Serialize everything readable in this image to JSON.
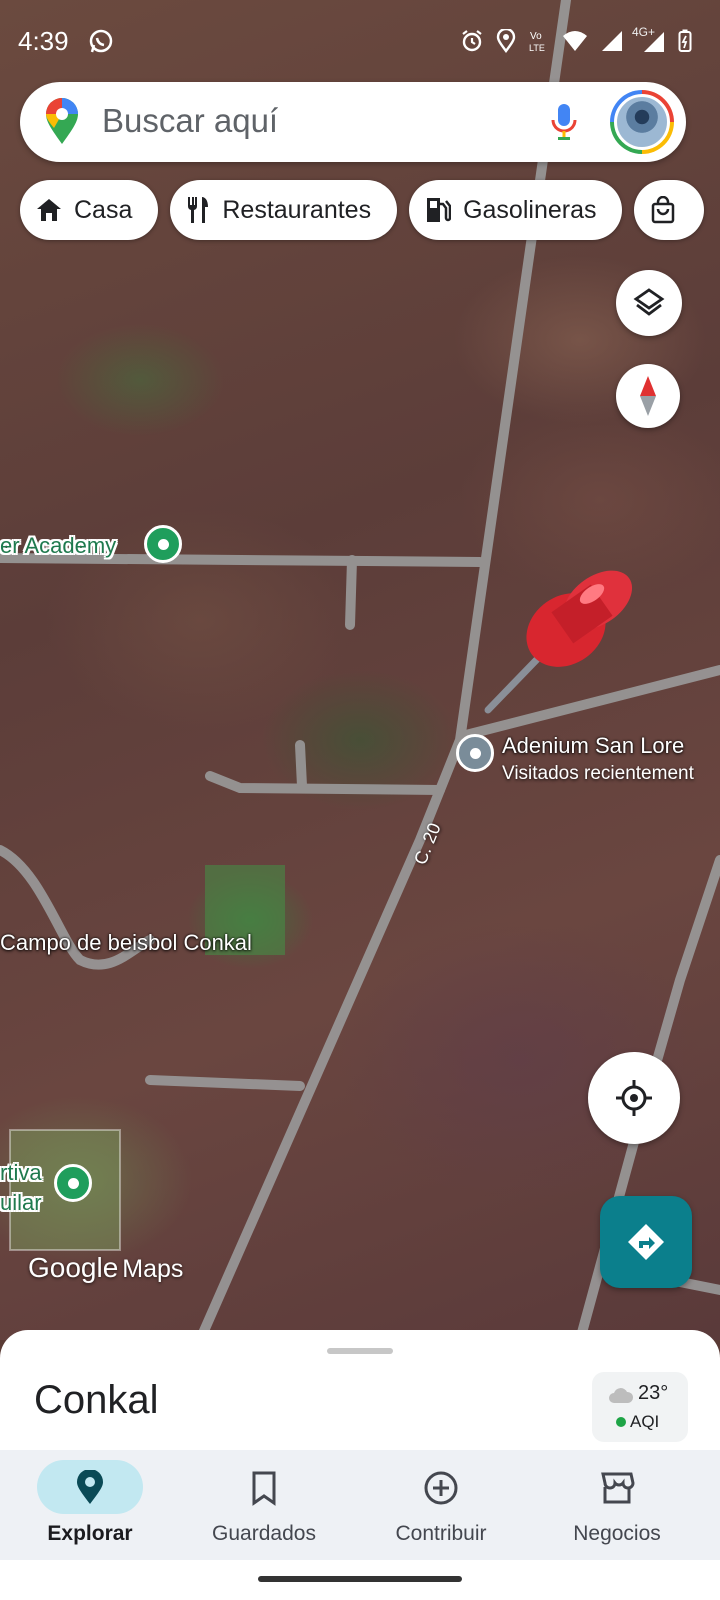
{
  "status_bar": {
    "time": "4:39",
    "icons": [
      "whatsapp-icon",
      "alarm-icon",
      "location-icon",
      "volte-icon",
      "wifi-icon",
      "signal-icon",
      "4g-signal-icon",
      "battery-icon"
    ],
    "network": "4G+"
  },
  "search": {
    "placeholder": "Buscar aquí",
    "icons": [
      "maps-pin-icon",
      "mic-icon",
      "avatar"
    ]
  },
  "chips": [
    {
      "label": "Casa",
      "icon": "home-icon"
    },
    {
      "label": "Restaurantes",
      "icon": "restaurant-icon"
    },
    {
      "label": "Gasolineras",
      "icon": "gas-station-icon"
    },
    {
      "label": "",
      "icon": "shopping-bag-icon"
    }
  ],
  "map": {
    "labels": {
      "academy": "er Academy",
      "adenium": "Adenium San Lore",
      "adenium_sub": "Visitados recientement",
      "road": "C. 20",
      "campo": "Campo de beisbol Conkal",
      "deportiva_1": "rtiva",
      "deportiva_2": "uilar"
    },
    "brand": {
      "google": "Google",
      "maps": "Maps"
    },
    "colors": {
      "poi_green": "#1f9e5c",
      "poi_gray": "#7a8c99",
      "road": "#9a9a9a",
      "pin_red": "#e0313c"
    }
  },
  "controls": {
    "layers": "layers-icon",
    "compass": "compass-icon",
    "my_location": "my-location-icon",
    "directions": "directions-icon"
  },
  "sheet": {
    "title": "Conkal",
    "weather": {
      "temp": "23°",
      "aqi": "AQI"
    }
  },
  "nav": [
    {
      "label": "Explorar",
      "icon": "explore-pin-icon",
      "active": true
    },
    {
      "label": "Guardados",
      "icon": "bookmark-icon",
      "active": false
    },
    {
      "label": "Contribuir",
      "icon": "add-circle-icon",
      "active": false
    },
    {
      "label": "Negocios",
      "icon": "storefront-icon",
      "active": false
    }
  ]
}
